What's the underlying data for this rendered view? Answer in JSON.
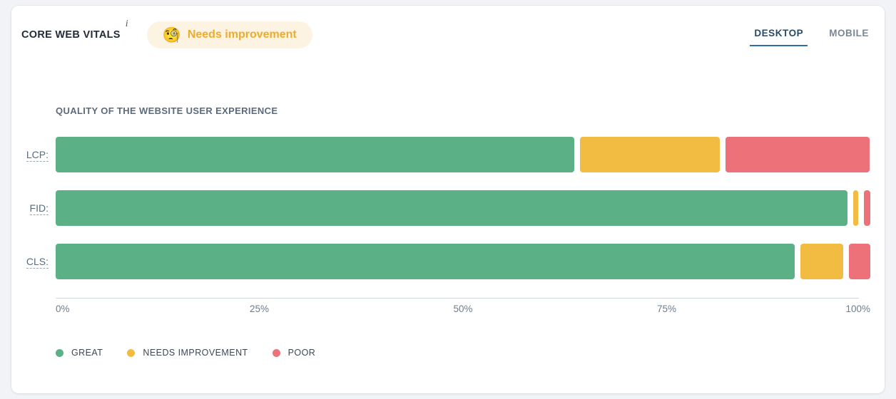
{
  "header": {
    "title": "CORE WEB VITALS",
    "info_icon": "info-icon",
    "status": {
      "emoji": "🧐",
      "label": "Needs improvement",
      "bg_color": "#fdf3e2",
      "text_color": "#eeab2d"
    },
    "tabs": [
      {
        "label": "DESKTOP",
        "active": true
      },
      {
        "label": "MOBILE",
        "active": false
      }
    ]
  },
  "chart_data": {
    "type": "bar",
    "orientation": "horizontal",
    "stacked": true,
    "title": "QUALITY OF THE WEBSITE USER EXPERIENCE",
    "xlabel": "",
    "ylabel": "",
    "xlim": [
      0,
      100
    ],
    "grid": false,
    "legend_position": "bottom-left",
    "categories": [
      "LCP:",
      "FID:",
      "CLS:"
    ],
    "tick_labels": [
      "0%",
      "25%",
      "50%",
      "75%",
      "100%"
    ],
    "tick_values": [
      0,
      25,
      50,
      75,
      100
    ],
    "series": [
      {
        "name": "GREAT",
        "color": "#5cb085",
        "values": [
          63.7,
          97.5,
          90.7
        ]
      },
      {
        "name": "NEEDS IMPROVEMENT",
        "color": "#f2bc42",
        "values": [
          17.1,
          0.6,
          5.3
        ]
      },
      {
        "name": "POOR",
        "color": "#ec7179",
        "values": [
          17.7,
          0.8,
          2.6
        ]
      }
    ],
    "rows": [
      {
        "label": "LCP:",
        "segments": [
          {
            "series": "GREAT",
            "pct": 63.7
          },
          {
            "series": "NEEDS IMPROVEMENT",
            "pct": 17.1
          },
          {
            "series": "POOR",
            "pct": 17.7
          }
        ]
      },
      {
        "label": "FID:",
        "segments": [
          {
            "series": "GREAT",
            "pct": 97.5
          },
          {
            "series": "NEEDS IMPROVEMENT",
            "pct": 0.6
          },
          {
            "series": "POOR",
            "pct": 0.8
          }
        ]
      },
      {
        "label": "CLS:",
        "segments": [
          {
            "series": "GREAT",
            "pct": 90.7
          },
          {
            "series": "NEEDS IMPROVEMENT",
            "pct": 5.3
          },
          {
            "series": "POOR",
            "pct": 2.6
          }
        ]
      }
    ],
    "legend": [
      {
        "label": "GREAT",
        "color": "#5cb085"
      },
      {
        "label": "NEEDS IMPROVEMENT",
        "color": "#f2bc42"
      },
      {
        "label": "POOR",
        "color": "#ec7179"
      }
    ]
  }
}
